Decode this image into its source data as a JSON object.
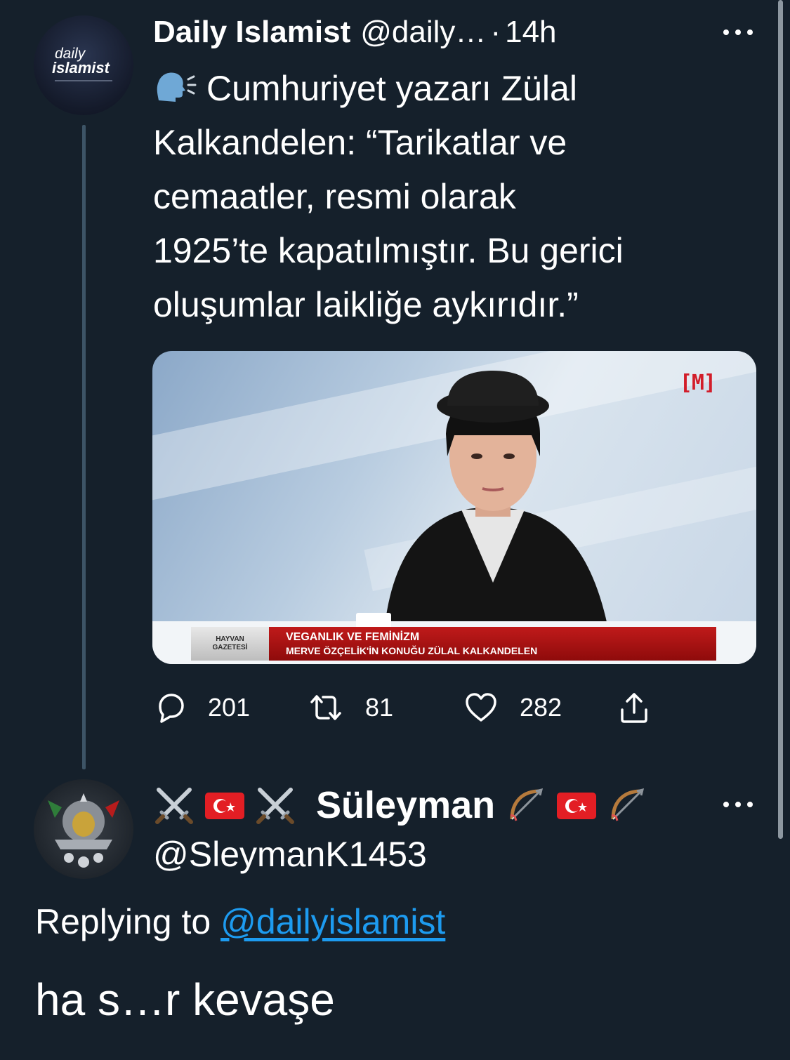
{
  "tweet": {
    "author_name": "Daily Islamist",
    "author_handle": "@daily…",
    "separator": "·",
    "time": "14h",
    "avatar_logo": {
      "line1": "daily",
      "line2": "islamist"
    },
    "speaker_icon": "speaking-head-icon",
    "text": "Cumhuriyet yazarı Zülal\nKalkandelen: “Tarikatlar ve\ncemaatler, resmi olarak\n1925’te kapatılmıştır. Bu gerici\noluşumlar laikliğe aykırıdır.”",
    "media": {
      "channel_logo": "[M]",
      "lower_third_left": [
        "HAYVAN",
        "GAZETESİ"
      ],
      "lower_third_title": "VEGANLIK VE FEMİNİZM",
      "lower_third_subtitle": "MERVE ÖZÇELİK'İN KONUĞU ZÜLAL KALKANDELEN"
    },
    "actions": {
      "replies": "201",
      "retweets": "81",
      "likes": "282"
    }
  },
  "reply": {
    "author_name": "Süleyman",
    "author_handle": "@SleymanK1453",
    "replying_prefix": "Replying to",
    "replying_to": "@dailyislamist",
    "text": "ha s…r kevaşe",
    "name_emojis_before": [
      "crossed-swords-icon",
      "turkey-flag-icon",
      "crossed-swords-icon"
    ],
    "name_emojis_after": [
      "bow-and-arrow-icon",
      "turkey-flag-icon",
      "bow-and-arrow-icon"
    ]
  },
  "colors": {
    "background": "#15202b",
    "link": "#1d9bf0",
    "thread_line": "#3d5466"
  }
}
